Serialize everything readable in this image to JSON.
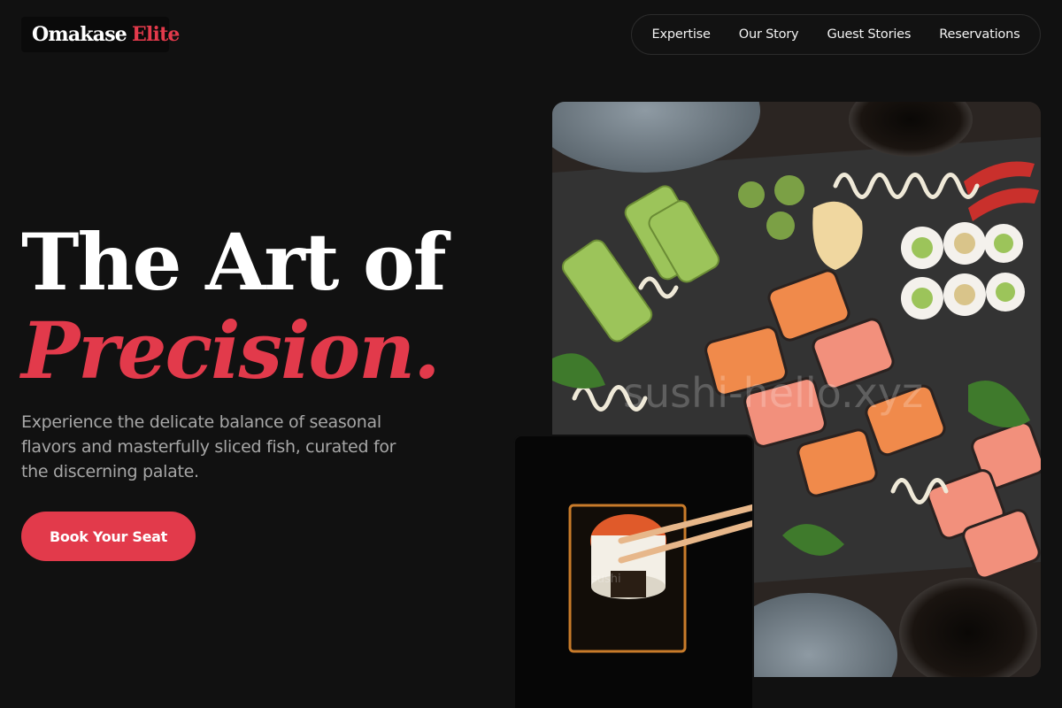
{
  "logo": {
    "brand": "Omakase",
    "accent": "Elite"
  },
  "nav": {
    "items": [
      {
        "label": "Expertise"
      },
      {
        "label": "Our Story"
      },
      {
        "label": "Guest Stories"
      },
      {
        "label": "Reservations"
      }
    ]
  },
  "hero": {
    "title_line1": "The Art of",
    "title_line2": "Precision.",
    "subtitle": "Experience the delicate balance of seasonal flavors and masterfully sliced fish, curated for the discerning palate.",
    "cta_label": "Book Your Seat"
  },
  "colors": {
    "background": "#111111",
    "accent": "#e23a4b",
    "text_primary": "#ffffff",
    "text_secondary": "#a7a7a7"
  },
  "images": {
    "main": {
      "watermark": "sushi-hello.xyz"
    },
    "small": {
      "watermark": "sushi"
    }
  }
}
